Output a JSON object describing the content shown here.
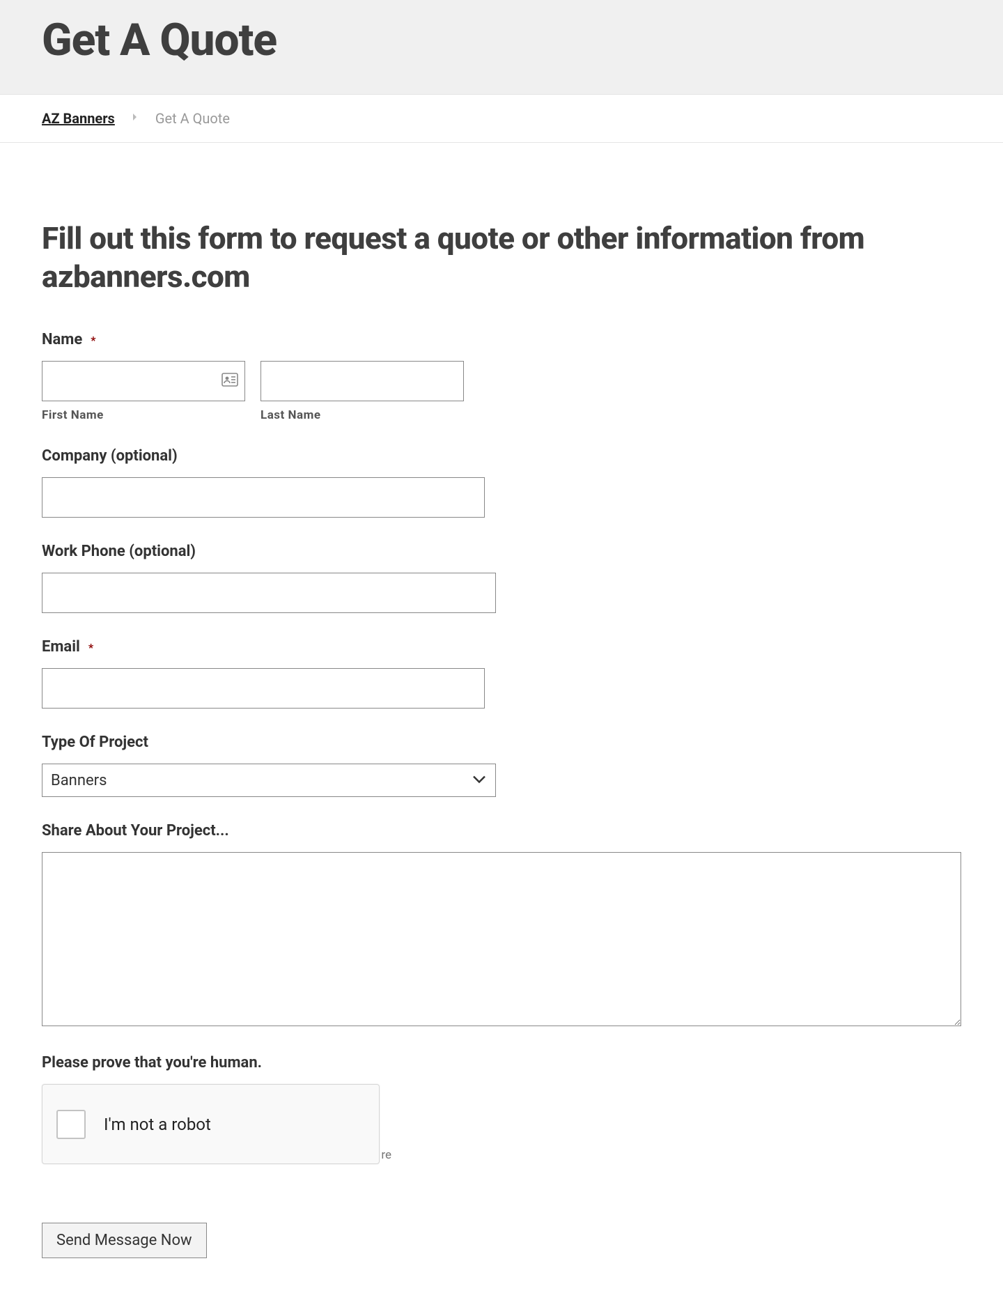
{
  "header": {
    "title": "Get A Quote"
  },
  "breadcrumb": {
    "home": "AZ Banners",
    "current": "Get A Quote"
  },
  "form": {
    "heading": "Fill out this form to request a quote or other information from azbanners.com",
    "name": {
      "label": "Name",
      "first_sub": "First Name",
      "last_sub": "Last Name",
      "first_value": "",
      "last_value": ""
    },
    "company": {
      "label": "Company (optional)",
      "value": ""
    },
    "phone": {
      "label": "Work Phone (optional)",
      "value": ""
    },
    "email": {
      "label": "Email",
      "value": ""
    },
    "project_type": {
      "label": "Type Of Project",
      "selected": "Banners"
    },
    "share": {
      "label": "Share About Your Project...",
      "value": ""
    },
    "captcha": {
      "label": "Please prove that you're human.",
      "text": "I'm not a robot",
      "brand": "re"
    },
    "submit_label": "Send Message Now"
  }
}
